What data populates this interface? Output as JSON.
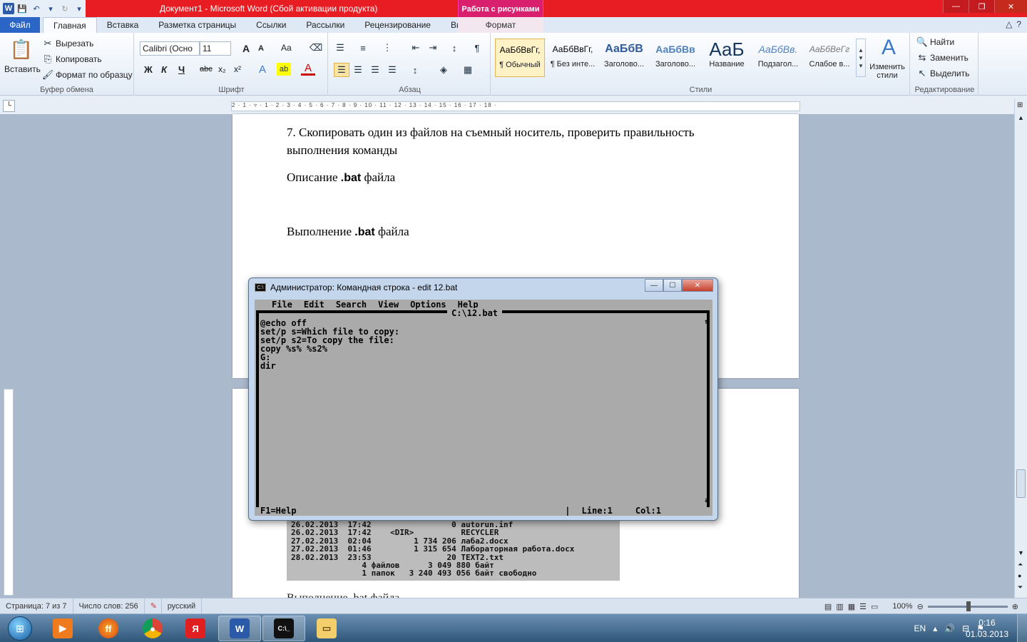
{
  "window": {
    "title": "Документ1  -  Microsoft Word (Сбой активации продукта)",
    "context_tab_header": "Работа с рисунками"
  },
  "tabs": {
    "file": "Файл",
    "items": [
      "Главная",
      "Вставка",
      "Разметка страницы",
      "Ссылки",
      "Рассылки",
      "Рецензирование",
      "Вид"
    ],
    "context": "Формат"
  },
  "ribbon": {
    "clipboard": {
      "paste": "Вставить",
      "cut": "Вырезать",
      "copy": "Копировать",
      "format_painter": "Формат по образцу",
      "label": "Буфер обмена"
    },
    "font": {
      "name": "Calibri (Осно",
      "size": "11",
      "label": "Шрифт",
      "bold": "Ж",
      "italic": "К",
      "underline": "Ч",
      "strike": "abc",
      "sub": "x₂",
      "sup": "x²",
      "grow": "A",
      "shrink": "A",
      "case": "Aa"
    },
    "paragraph": {
      "label": "Абзац"
    },
    "styles": {
      "label": "Стили",
      "items": [
        {
          "preview": "АаБбВвГг,",
          "name": "¶ Обычный"
        },
        {
          "preview": "АаБбВвГг,",
          "name": "¶ Без инте..."
        },
        {
          "preview": "АаБбВ",
          "name": "Заголово..."
        },
        {
          "preview": "АаБбВв",
          "name": "Заголово..."
        },
        {
          "preview": "АаБ",
          "name": "Название"
        },
        {
          "preview": "АаБбВв.",
          "name": "Подзагол..."
        },
        {
          "preview": "АаБбВеГг",
          "name": "Слабое в..."
        }
      ],
      "change_styles": "Изменить стили"
    },
    "editing": {
      "label": "Редактирование",
      "find": "Найти",
      "replace": "Заменить",
      "select": "Выделить"
    }
  },
  "ruler": {
    "ticks": "2 · 1 · ▿ · 1 · 2 · 3 · 4 · 5 · 6 · 7 · 8 · 9 · 10 · 11 · 12 · 13 · 14 · 15 · 16 · 17 · 18 ·"
  },
  "document": {
    "item7_line1": "7. Скопировать один из файлов на съемный носитель, проверить правильность",
    "item7_line2": "выполнения команды",
    "desc_prefix": "Описание ",
    "desc_bold": ".bat",
    "desc_suffix": " файла",
    "exec_prefix": "Выполнение ",
    "exec_bold": ".bat",
    "exec_suffix": " файла",
    "dir_listing": [
      "26.02.2013  17:42                 0 autorun.inf",
      "26.02.2013  17:42    <DIR>          RECYCLER",
      "27.02.2013  02:04         1 734 206 лаба2.docx",
      "27.02.2013  01:46         1 315 654 Лабораторная работа.docx",
      "28.02.2013  23:53                20 TEXT2.txt",
      "               4 файлов      3 049 880 байт",
      "               1 папок   3 240 493 056 байт свободно"
    ],
    "page2_bottom_text": "Выполнение .bat файла"
  },
  "cmd": {
    "title": "Администратор: Командная строка - edit  12.bat",
    "menu": [
      "File",
      "Edit",
      "Search",
      "View",
      "Options",
      "Help"
    ],
    "file_title": "C:\\12.bat",
    "code": [
      "@echo off",
      "set/p s=Which file to copy:",
      "set/p s2=To copy the file:",
      "copy %s% %s2%",
      "G:",
      "dir"
    ],
    "status_help": "F1=Help",
    "status_line": "Line:1",
    "status_col": "Col:1"
  },
  "statusbar": {
    "page": "Страница: 7 из 7",
    "words": "Число слов: 256",
    "language": "русский",
    "zoom": "100%"
  },
  "taskbar": {
    "apps": [
      "media-player",
      "firefox",
      "chrome",
      "yandex",
      "word",
      "cmd",
      "explorer"
    ],
    "lang": "EN",
    "time": "0:16",
    "date": "01.03.2013"
  }
}
